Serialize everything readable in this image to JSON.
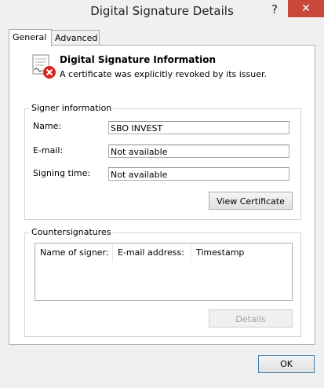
{
  "window": {
    "title": "Digital Signature Details",
    "help_label": "?",
    "close_label": "✕"
  },
  "tabs": [
    {
      "label": "General",
      "active": true
    },
    {
      "label": "Advanced",
      "active": false
    }
  ],
  "info": {
    "icon": "certificate-revoked-icon",
    "title": "Digital Signature Information",
    "message": "A certificate was explicitly revoked by its issuer."
  },
  "signer": {
    "group_label": "Signer information",
    "name_label": "Name:",
    "name_value": "SBO INVEST",
    "email_label": "E-mail:",
    "email_value": "Not available",
    "time_label": "Signing time:",
    "time_value": "Not available",
    "view_certificate_label": "View Certificate"
  },
  "countersignatures": {
    "group_label": "Countersignatures",
    "columns": [
      "Name of signer:",
      "E-mail address:",
      "Timestamp"
    ],
    "details_label": "Details"
  },
  "footer": {
    "ok_label": "OK"
  },
  "colors": {
    "close_button": "#c7483b",
    "revoked_icon": "#d9261c"
  }
}
